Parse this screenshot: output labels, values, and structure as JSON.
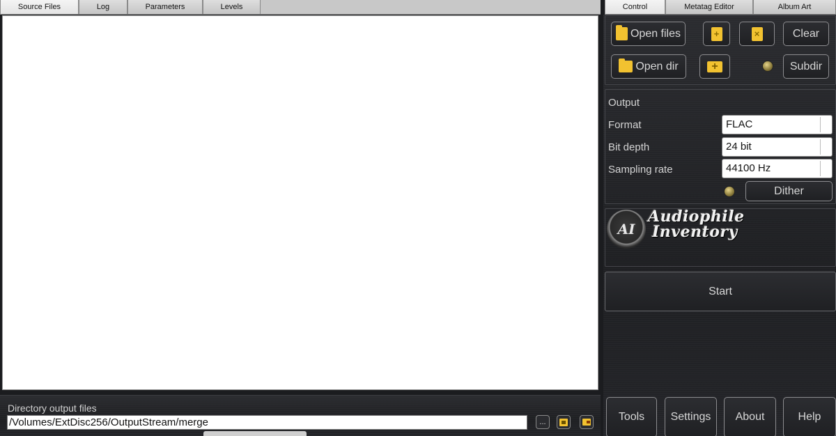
{
  "left_tabs": [
    "Source Files",
    "Log",
    "Parameters",
    "Levels"
  ],
  "right_tabs": [
    "Control",
    "Metatag Editor",
    "Album Art"
  ],
  "control": {
    "open_files": "Open files",
    "clear": "Clear",
    "open_dir": "Open dir",
    "subdir": "Subdir"
  },
  "output": {
    "header": "Output",
    "format_label": "Format",
    "format_value": "FLAC",
    "bit_depth_label": "Bit depth",
    "bit_depth_value": "24 bit",
    "sampling_rate_label": "Sampling rate",
    "sampling_rate_value": "44100 Hz",
    "dither": "Dither"
  },
  "logo": {
    "monogram": "AI",
    "line1": "Audiophile",
    "line2": "Inventory"
  },
  "start": "Start",
  "bottom_buttons": [
    "Tools",
    "Settings",
    "About",
    "Help"
  ],
  "directory": {
    "label": "Directory output files",
    "path": "/Volumes/ExtDisc256/OutputStream/merge",
    "browse": "..."
  },
  "colors": {
    "accent_folder": "#f2c230",
    "background": "#1b1c1f"
  },
  "icons": [
    "folder-icon",
    "add-file-icon",
    "remove-file-icon",
    "add-folder-icon",
    "open-folder-icon",
    "folder-arrow-icon"
  ]
}
